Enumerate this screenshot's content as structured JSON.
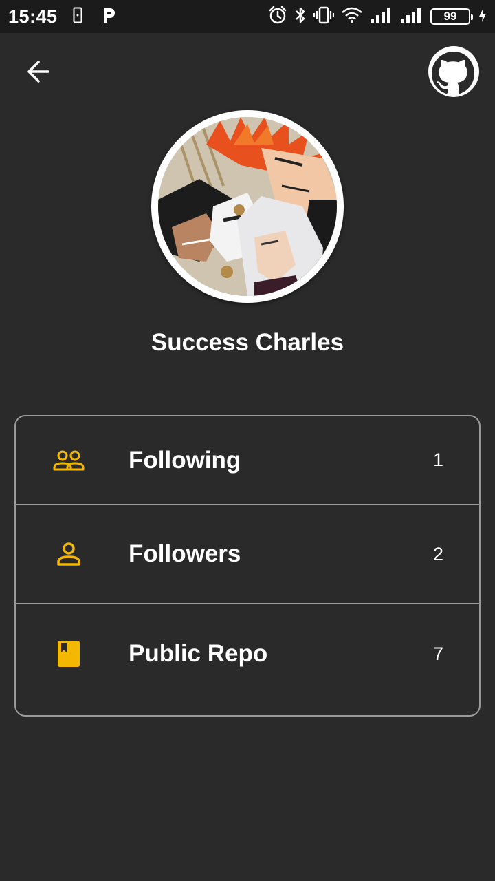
{
  "status_bar": {
    "time": "15:45",
    "battery_level": "99",
    "icons": [
      "sim-icon",
      "p-app-icon",
      "alarm-icon",
      "bluetooth-icon",
      "vibrate-icon",
      "wifi-icon",
      "signal-icon",
      "signal-icon",
      "battery-icon",
      "charging-icon"
    ]
  },
  "header": {
    "back_icon": "arrow-left-icon",
    "github_icon": "github-icon"
  },
  "profile": {
    "name": "Success Charles",
    "avatar": "avatar-image"
  },
  "stats": [
    {
      "icon": "people-icon",
      "label": "Following",
      "count": "1"
    },
    {
      "icon": "person-icon",
      "label": "Followers",
      "count": "2"
    },
    {
      "icon": "book-icon",
      "label": "Public Repo",
      "count": "7"
    }
  ],
  "colors": {
    "background": "#2a2a2a",
    "status_bar": "#1b1b1b",
    "accent": "#f5b800",
    "border": "#9a9a9a",
    "text": "#ffffff"
  }
}
